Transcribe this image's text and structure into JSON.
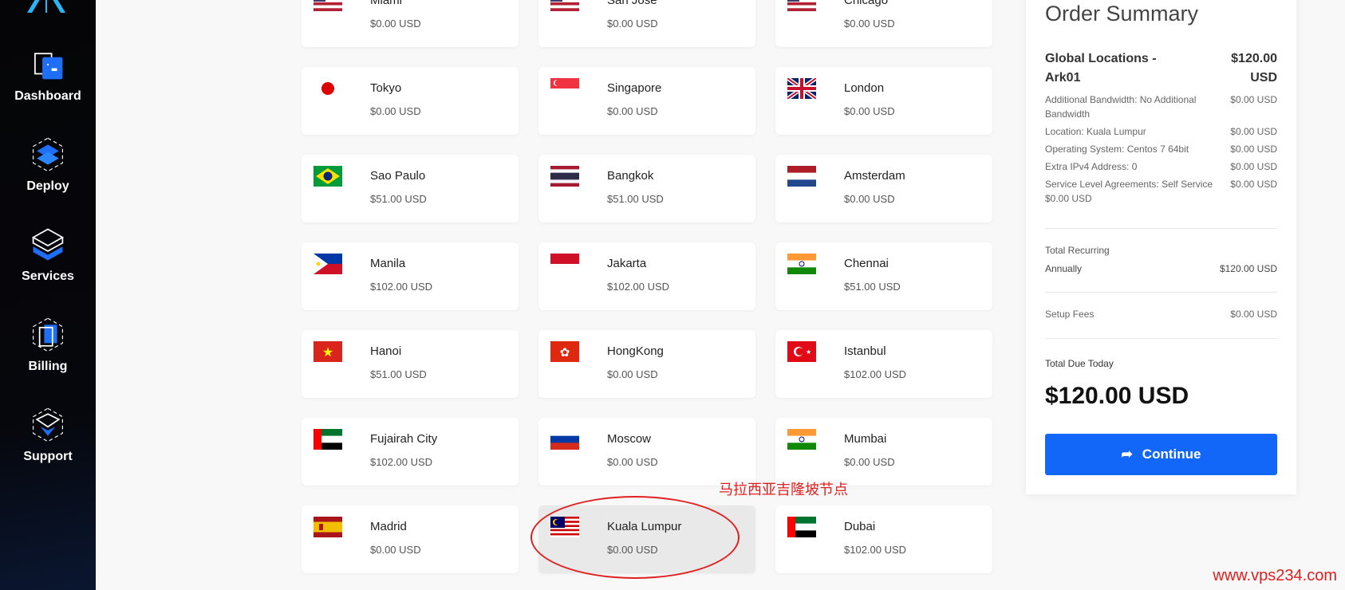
{
  "sidebar": {
    "items": [
      {
        "label": "Dashboard",
        "icon": "dashboard-icon"
      },
      {
        "label": "Deploy",
        "icon": "deploy-icon"
      },
      {
        "label": "Services",
        "icon": "services-icon"
      },
      {
        "label": "Billing",
        "icon": "billing-icon"
      },
      {
        "label": "Support",
        "icon": "support-icon"
      }
    ]
  },
  "locations": [
    {
      "name": "Miami",
      "price": "$0.00 USD",
      "flag": "us"
    },
    {
      "name": "San Jose",
      "price": "$0.00 USD",
      "flag": "us"
    },
    {
      "name": "Chicago",
      "price": "$0.00 USD",
      "flag": "us"
    },
    {
      "name": "Tokyo",
      "price": "$0.00 USD",
      "flag": "jp"
    },
    {
      "name": "Singapore",
      "price": "$0.00 USD",
      "flag": "sg"
    },
    {
      "name": "London",
      "price": "$0.00 USD",
      "flag": "gb"
    },
    {
      "name": "Sao Paulo",
      "price": "$51.00 USD",
      "flag": "br"
    },
    {
      "name": "Bangkok",
      "price": "$51.00 USD",
      "flag": "th"
    },
    {
      "name": "Amsterdam",
      "price": "$0.00 USD",
      "flag": "nl"
    },
    {
      "name": "Manila",
      "price": "$102.00 USD",
      "flag": "ph"
    },
    {
      "name": "Jakarta",
      "price": "$102.00 USD",
      "flag": "id"
    },
    {
      "name": "Chennai",
      "price": "$51.00 USD",
      "flag": "in"
    },
    {
      "name": "Hanoi",
      "price": "$51.00 USD",
      "flag": "vn"
    },
    {
      "name": "HongKong",
      "price": "$0.00 USD",
      "flag": "hk"
    },
    {
      "name": "Istanbul",
      "price": "$102.00 USD",
      "flag": "tr"
    },
    {
      "name": "Fujairah City",
      "price": "$102.00 USD",
      "flag": "ae"
    },
    {
      "name": "Moscow",
      "price": "$0.00 USD",
      "flag": "ru"
    },
    {
      "name": "Mumbai",
      "price": "$0.00 USD",
      "flag": "in"
    },
    {
      "name": "Madrid",
      "price": "$0.00 USD",
      "flag": "es"
    },
    {
      "name": "Kuala Lumpur",
      "price": "$0.00 USD",
      "flag": "my",
      "selected": true
    },
    {
      "name": "Dubai",
      "price": "$102.00 USD",
      "flag": "ae"
    }
  ],
  "summary": {
    "title": "Order Summary",
    "product": "Global Locations - Ark01",
    "product_price": "$120.00 USD",
    "lines": [
      {
        "label": "Additional Bandwidth: No Additional Bandwidth",
        "value": "$0.00 USD"
      },
      {
        "label": "Location: Kuala Lumpur",
        "value": "$0.00 USD"
      },
      {
        "label": "Operating System: Centos 7 64bit",
        "value": "$0.00 USD"
      },
      {
        "label": "Extra IPv4 Address: 0",
        "value": "$0.00 USD"
      },
      {
        "label": "Service Level Agreements: Self Service $0.00 USD",
        "value": "$0.00 USD"
      }
    ],
    "recurring_label": "Total Recurring",
    "cycle": "Annually",
    "cycle_price": "$120.00 USD",
    "setup_label": "Setup Fees",
    "setup_price": "$0.00 USD",
    "due_label": "Total Due Today",
    "due": "$120.00 USD",
    "continue": "Continue"
  },
  "annotation": "马拉西亚吉隆坡节点",
  "watermark": "www.vps234.com",
  "colors": {
    "accent": "#1367f8",
    "annotation": "#e02020"
  }
}
